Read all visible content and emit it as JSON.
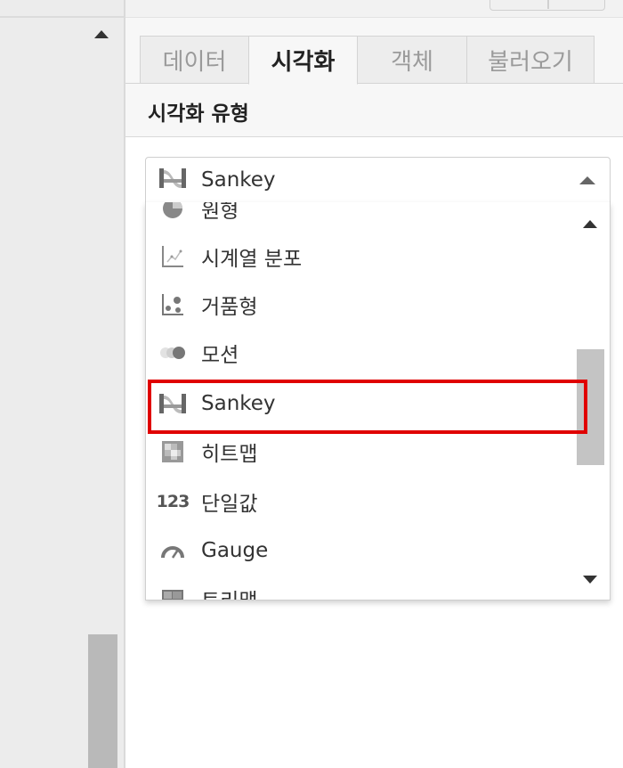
{
  "tabs": [
    {
      "label": "데이터"
    },
    {
      "label": "시각화"
    },
    {
      "label": "객체"
    },
    {
      "label": "불러오기"
    }
  ],
  "section_title": "시각화 유형",
  "select": {
    "value": "Sankey",
    "icon": "sankey-icon"
  },
  "options": [
    {
      "label": "원형",
      "icon": "pie-icon"
    },
    {
      "label": "시계열 분포",
      "icon": "timeseries-distribution-icon"
    },
    {
      "label": "거품형",
      "icon": "bubble-icon"
    },
    {
      "label": "모션",
      "icon": "motion-icon"
    },
    {
      "label": "Sankey",
      "icon": "sankey-icon"
    },
    {
      "label": "히트맵",
      "icon": "heatmap-icon"
    },
    {
      "label": "단일값",
      "icon": "single-value-icon"
    },
    {
      "label": "Gauge",
      "icon": "gauge-icon"
    },
    {
      "label": "트리맵",
      "icon": "treemap-icon"
    }
  ],
  "single_value_icon_text": "123",
  "colors": {
    "highlight": "#e00000"
  }
}
